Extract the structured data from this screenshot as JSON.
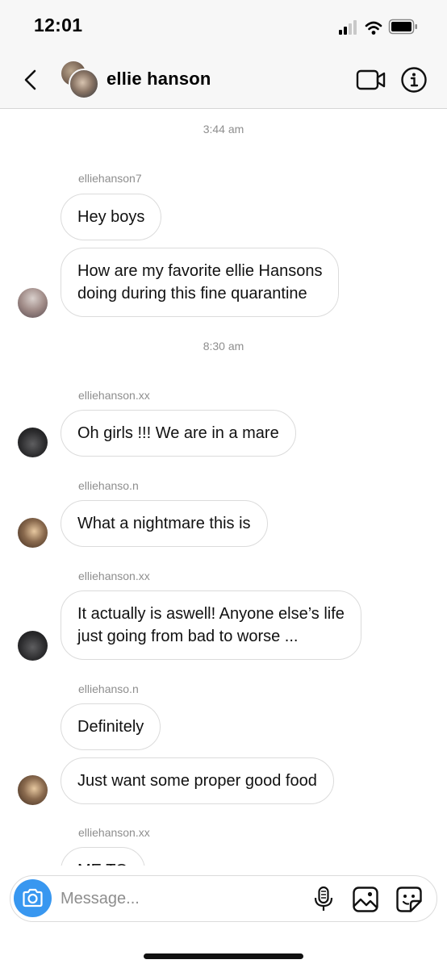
{
  "status_bar": {
    "time": "12:01"
  },
  "header": {
    "contact_name": "ellie hanson"
  },
  "messages": [
    {
      "type": "timestamp",
      "text": "3:44 am"
    },
    {
      "type": "username",
      "text": "elliehanson7"
    },
    {
      "type": "bubble",
      "text": "Hey boys"
    },
    {
      "type": "bubble",
      "text": "How are my favorite ellie Hansons\ndoing during this fine quarantine"
    },
    {
      "type": "timestamp",
      "text": "8:30 am"
    },
    {
      "type": "username",
      "text": "elliehanson.xx"
    },
    {
      "type": "bubble",
      "text": "Oh girls !!! We are in a mare"
    },
    {
      "type": "username",
      "text": "elliehanso.n"
    },
    {
      "type": "bubble",
      "text": "What a nightmare this is"
    },
    {
      "type": "username",
      "text": "elliehanson.xx"
    },
    {
      "type": "bubble",
      "text": "It actually is aswell! Anyone else’s life\njust going from bad to worse ..."
    },
    {
      "type": "username",
      "text": "elliehanso.n"
    },
    {
      "type": "bubble",
      "text": "Definitely"
    },
    {
      "type": "bubble",
      "text": "Just want some proper good food"
    },
    {
      "type": "username",
      "text": "elliehanson.xx"
    },
    {
      "type": "bubble",
      "text": "ME TO"
    }
  ],
  "composer": {
    "placeholder": "Message..."
  },
  "icons": {
    "back": "chevron-left-icon",
    "video": "video-camera-icon",
    "info": "info-icon",
    "camera": "camera-icon",
    "mic": "microphone-icon",
    "gallery": "gallery-icon",
    "sticker": "sticker-icon"
  },
  "colors": {
    "accent": "#3897f0",
    "bubble_border": "#dbdbdb",
    "meta_text": "#8e8e8e"
  }
}
